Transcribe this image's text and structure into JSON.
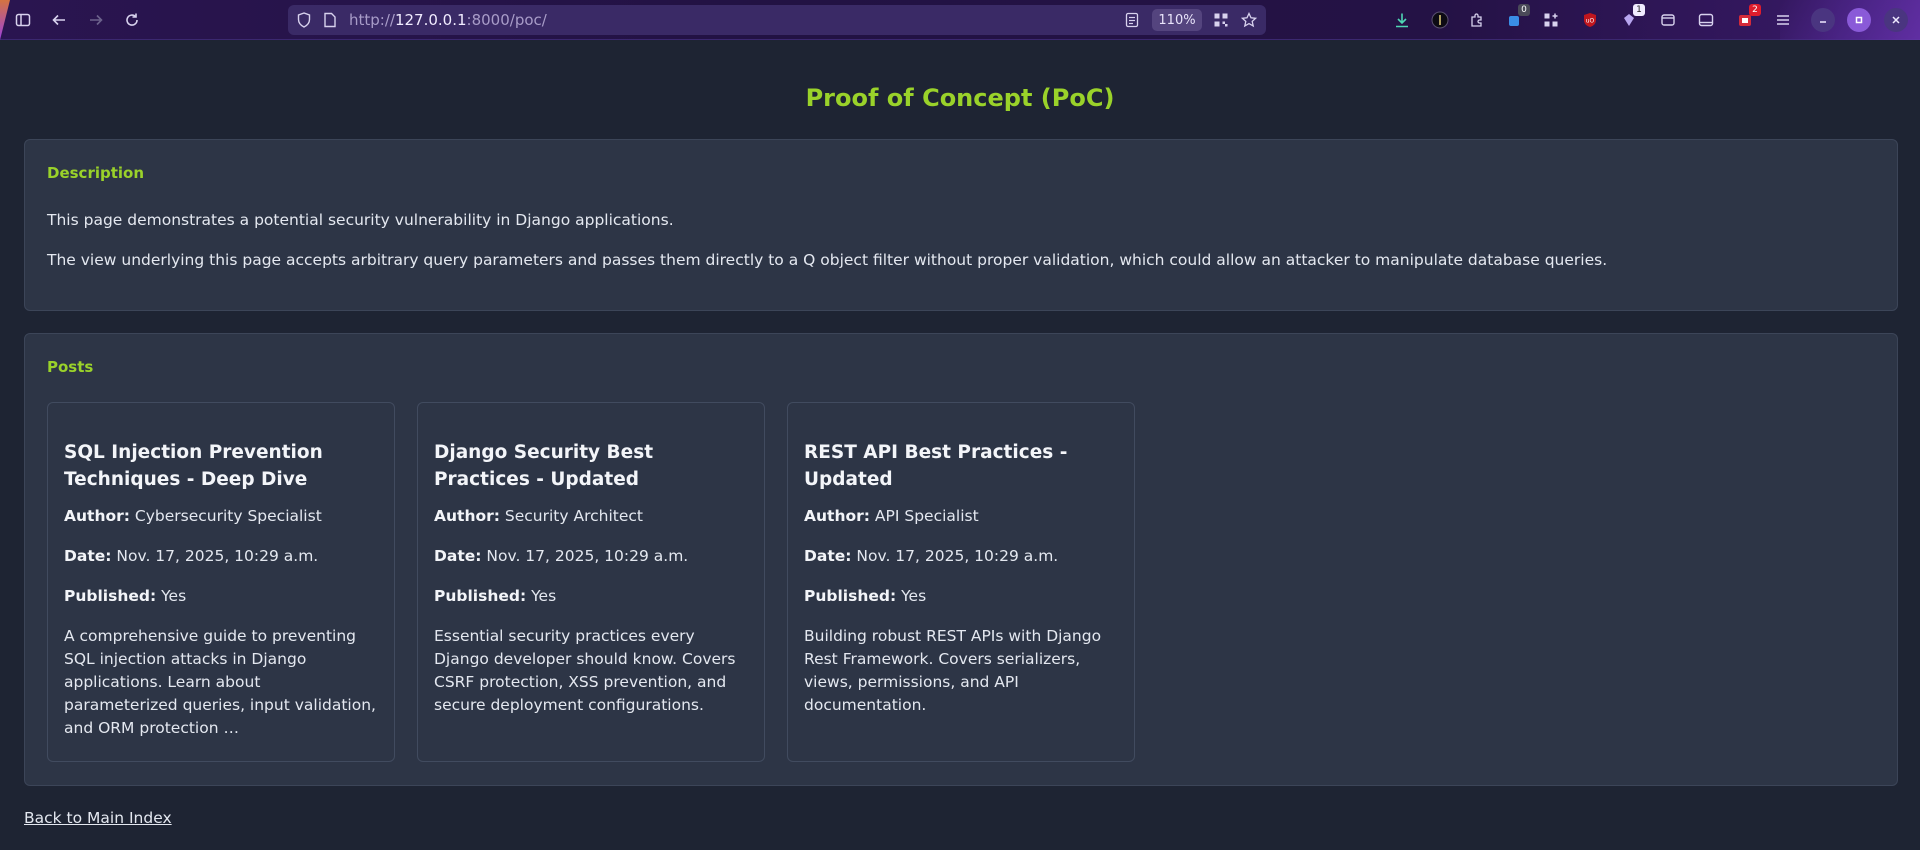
{
  "browser": {
    "url_scheme": "http://",
    "url_host": "127.0.0.1",
    "url_rest": ":8000/poc/",
    "zoom": "110%",
    "badges": {
      "extension_count": "0",
      "notifications": "1",
      "alerts": "2"
    },
    "icons": {
      "sidebar": "sidebar-icon",
      "back": "back-arrow-icon",
      "forward": "forward-arrow-icon",
      "reload": "reload-icon",
      "shield": "shield-icon",
      "page": "page-icon",
      "reader": "reader-view-icon",
      "qr": "qr-code-icon",
      "bookmark": "star-icon"
    }
  },
  "page": {
    "title": "Proof of Concept (PoC)",
    "description": {
      "heading": "Description",
      "paragraph1": "This page demonstrates a potential security vulnerability in Django applications.",
      "paragraph2": "The view underlying this page accepts arbitrary query parameters and passes them directly to a Q object filter without proper validation, which could allow an attacker to manipulate database queries."
    },
    "posts": {
      "heading": "Posts",
      "labels": {
        "author": "Author:",
        "date": "Date:",
        "published": "Published:"
      },
      "items": [
        {
          "title": "SQL Injection Prevention Techniques - Deep Dive",
          "author": "Cybersecurity Specialist",
          "date": "Nov. 17, 2025, 10:29 a.m.",
          "published": "Yes",
          "body": "A comprehensive guide to preventing SQL injection attacks in Django applications. Learn about parameterized queries, input validation, and ORM protection …"
        },
        {
          "title": "Django Security Best Practices - Updated",
          "author": "Security Architect",
          "date": "Nov. 17, 2025, 10:29 a.m.",
          "published": "Yes",
          "body": "Essential security practices every Django developer should know. Covers CSRF protection, XSS prevention, and secure deployment configurations."
        },
        {
          "title": "REST API Best Practices - Updated",
          "author": "API Specialist",
          "date": "Nov. 17, 2025, 10:29 a.m.",
          "published": "Yes",
          "body": "Building robust REST APIs with Django Rest Framework. Covers serializers, views, permissions, and API documentation."
        }
      ]
    },
    "back_link": "Back to Main Index"
  },
  "colors": {
    "accent": "#9ad22a",
    "background": "#1e2433",
    "panel": "#2d3546",
    "text": "#e4e8f0"
  }
}
